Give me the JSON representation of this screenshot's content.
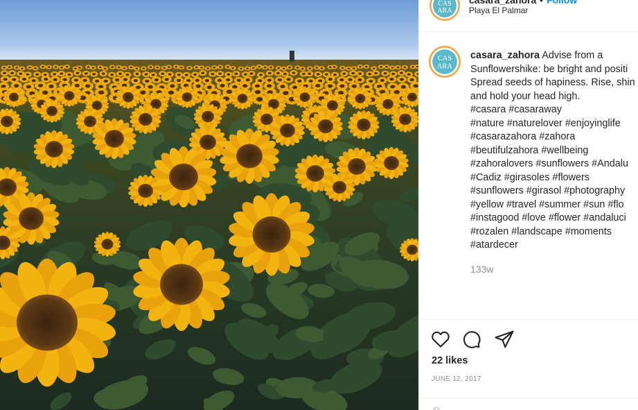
{
  "post": {
    "photo_alt": "Sunflower field",
    "icon": "sunflower-field-photo"
  },
  "header": {
    "username": "casara_zahora",
    "separator": "•",
    "follow_label": "Follow",
    "location": "Playa El Palmar"
  },
  "profile": {
    "avatar_text_top": "CAS",
    "avatar_text_bottom": "ARA"
  },
  "caption": {
    "username": "casara_zahora",
    "first_line_text": "Advise from a",
    "lines": [
      "Sunflowershike: be bright and positi",
      "Spread seeds of hapiness. Rise, shin",
      "and hold your head high.",
      "#casara #casaraway",
      "#nature #naturelover #enjoyinglife",
      "#casarazahora #zahora",
      "#beutifulzahora #wellbeing",
      "#zahoralovers #sunflowers #Andalu",
      "#Cadiz #girasoles #flowers",
      "#sunflowers #girasol #photography",
      "#yellow #travel #summer #sun #flo",
      "#instagood #love #flower #andaluci",
      "#rozalen #landscape #moments",
      "#atardecer"
    ],
    "time_ago": "133w"
  },
  "actions": {
    "like_icon": "heart-icon",
    "comment_icon": "comment-icon",
    "share_icon": "share-icon"
  },
  "likes": "22 likes",
  "date": "JUNE 12, 2017",
  "colors": {
    "text": "#262626",
    "secondary": "#8e8e8e",
    "link": "#0095f6",
    "divider": "#efefef",
    "avatar_bg": "#5bb8c9",
    "avatar_ring": "#f7a33b"
  }
}
